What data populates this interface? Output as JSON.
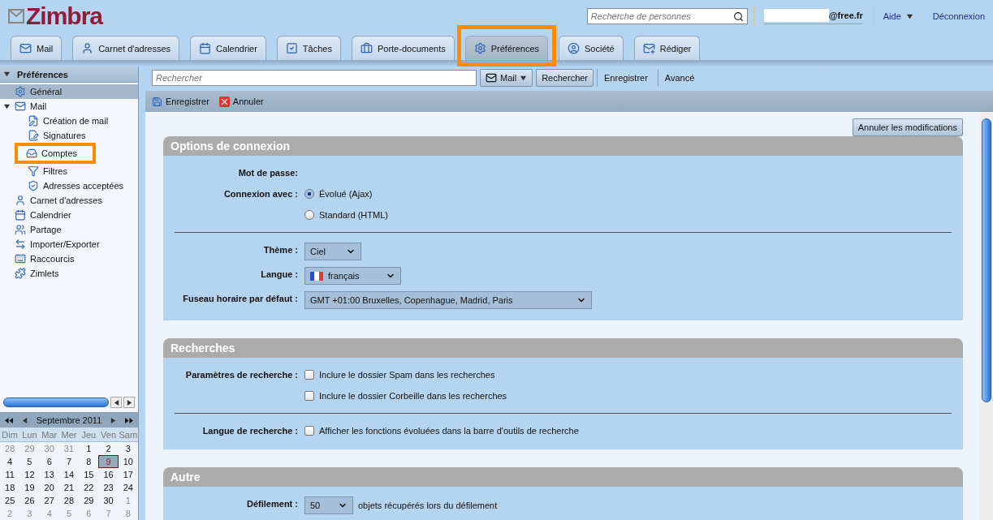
{
  "header": {
    "logo": "Zimbra",
    "people_search": {
      "placeholder": "Recherche de personnes"
    },
    "account": "@free.fr",
    "help": "Aide",
    "logout": "Déconnexion"
  },
  "tabs": [
    {
      "label": "Mail",
      "selected": false,
      "highlighted": false
    },
    {
      "label": "Carnet d'adresses",
      "selected": false,
      "highlighted": false
    },
    {
      "label": "Calendrier",
      "selected": false,
      "highlighted": false
    },
    {
      "label": "Tâches",
      "selected": false,
      "highlighted": false
    },
    {
      "label": "Porte-documents",
      "selected": false,
      "highlighted": false
    },
    {
      "label": "Préférences",
      "selected": true,
      "highlighted": true
    },
    {
      "label": "Société",
      "selected": false,
      "highlighted": false
    },
    {
      "label": "Rédiger",
      "selected": false,
      "highlighted": false
    }
  ],
  "sidebar": {
    "title": "Préférences",
    "items": [
      {
        "label": "Général",
        "selected": true,
        "highlighted": false
      },
      {
        "label": "Mail",
        "selected": false,
        "highlighted": false,
        "expanded": true,
        "children": [
          {
            "label": "Création de mail",
            "selected": false,
            "highlighted": false
          },
          {
            "label": "Signatures",
            "selected": false,
            "highlighted": false
          },
          {
            "label": "Comptes",
            "selected": false,
            "highlighted": true
          },
          {
            "label": "Filtres",
            "selected": false,
            "highlighted": false
          },
          {
            "label": "Adresses acceptées",
            "selected": false,
            "highlighted": false
          }
        ]
      },
      {
        "label": "Carnet d'adresses",
        "selected": false,
        "highlighted": false
      },
      {
        "label": "Calendrier",
        "selected": false,
        "highlighted": false
      },
      {
        "label": "Partage",
        "selected": false,
        "highlighted": false
      },
      {
        "label": "Importer/Exporter",
        "selected": false,
        "highlighted": false
      },
      {
        "label": "Raccourcis",
        "selected": false,
        "highlighted": false
      },
      {
        "label": "Zimlets",
        "selected": false,
        "highlighted": false
      }
    ]
  },
  "calendar": {
    "month": "Septembre 2011",
    "weekdays": [
      "Dim",
      "Lun",
      "Mar",
      "Mer",
      "Jeu",
      "Ven",
      "Sam"
    ],
    "weeks": [
      [
        {
          "day": "28",
          "muted": true,
          "selected": false
        },
        {
          "day": "29",
          "muted": true,
          "selected": false
        },
        {
          "day": "30",
          "muted": true,
          "selected": false
        },
        {
          "day": "31",
          "muted": true,
          "selected": false
        },
        {
          "day": "1",
          "muted": false,
          "selected": false
        },
        {
          "day": "2",
          "muted": false,
          "selected": false
        },
        {
          "day": "3",
          "muted": false,
          "selected": false
        }
      ],
      [
        {
          "day": "4",
          "muted": false,
          "selected": false
        },
        {
          "day": "5",
          "muted": false,
          "selected": false
        },
        {
          "day": "6",
          "muted": false,
          "selected": false
        },
        {
          "day": "7",
          "muted": false,
          "selected": false
        },
        {
          "day": "8",
          "muted": false,
          "selected": false
        },
        {
          "day": "9",
          "muted": false,
          "selected": true
        },
        {
          "day": "10",
          "muted": false,
          "selected": false
        }
      ],
      [
        {
          "day": "11",
          "muted": false,
          "selected": false
        },
        {
          "day": "12",
          "muted": false,
          "selected": false
        },
        {
          "day": "13",
          "muted": false,
          "selected": false
        },
        {
          "day": "14",
          "muted": false,
          "selected": false
        },
        {
          "day": "15",
          "muted": false,
          "selected": false
        },
        {
          "day": "16",
          "muted": false,
          "selected": false
        },
        {
          "day": "17",
          "muted": false,
          "selected": false
        }
      ],
      [
        {
          "day": "18",
          "muted": false,
          "selected": false
        },
        {
          "day": "19",
          "muted": false,
          "selected": false
        },
        {
          "day": "20",
          "muted": false,
          "selected": false
        },
        {
          "day": "21",
          "muted": false,
          "selected": false
        },
        {
          "day": "22",
          "muted": false,
          "selected": false
        },
        {
          "day": "23",
          "muted": false,
          "selected": false
        },
        {
          "day": "24",
          "muted": false,
          "selected": false
        }
      ],
      [
        {
          "day": "25",
          "muted": false,
          "selected": false
        },
        {
          "day": "26",
          "muted": false,
          "selected": false
        },
        {
          "day": "27",
          "muted": false,
          "selected": false
        },
        {
          "day": "28",
          "muted": false,
          "selected": false
        },
        {
          "day": "29",
          "muted": false,
          "selected": false
        },
        {
          "day": "30",
          "muted": false,
          "selected": false
        },
        {
          "day": "1",
          "muted": true,
          "selected": false
        }
      ],
      [
        {
          "day": "2",
          "muted": true,
          "selected": false
        },
        {
          "day": "3",
          "muted": true,
          "selected": false
        },
        {
          "day": "4",
          "muted": true,
          "selected": false
        },
        {
          "day": "5",
          "muted": true,
          "selected": false
        },
        {
          "day": "6",
          "muted": true,
          "selected": false
        },
        {
          "day": "7",
          "muted": true,
          "selected": false
        },
        {
          "day": "8",
          "muted": true,
          "selected": false
        }
      ]
    ]
  },
  "search_bar": {
    "placeholder": "Rechercher",
    "scope": "Mail",
    "search": "Rechercher",
    "save": "Enregistrer",
    "advanced": "Avancé"
  },
  "actions": [
    {
      "label": "Enregistrer",
      "kind": "save"
    },
    {
      "label": "Annuler",
      "kind": "cancel"
    }
  ],
  "revert_button": "Annuler les modifications",
  "sections": [
    {
      "title": "Options de connexion",
      "rows": [
        {
          "kind": "text",
          "label": "Mot de passe:"
        },
        {
          "kind": "radio",
          "label": "Connexion avec :",
          "options": [
            {
              "label": "Évolué (Ajax)",
              "selected": true
            },
            {
              "label": "Standard (HTML)",
              "selected": false
            }
          ]
        },
        {
          "kind": "divider"
        },
        {
          "kind": "select",
          "label": "Thème :",
          "value": "Ciel"
        },
        {
          "kind": "flag-select",
          "label": "Langue :",
          "value": "français"
        },
        {
          "kind": "select",
          "label": "Fuseau horaire par défaut :",
          "value": "GMT +01:00 Bruxelles, Copenhague, Madrid, Paris"
        }
      ]
    },
    {
      "title": "Recherches",
      "rows": [
        {
          "kind": "checkbox",
          "label": "Paramètres de recherche :",
          "options": [
            {
              "label": "Inclure le dossier Spam dans les recherches",
              "checked": false
            },
            {
              "label": "Inclure le dossier Corbeille dans les recherches",
              "checked": false
            }
          ]
        },
        {
          "kind": "divider"
        },
        {
          "kind": "checkbox",
          "label": "Langue de recherche :",
          "options": [
            {
              "label": "Afficher les fonctions évoluées dans la barre d'outils de recherche",
              "checked": false
            }
          ]
        }
      ]
    },
    {
      "title": "Autre",
      "rows": [
        {
          "kind": "select",
          "label": "Défilement :",
          "value": "50",
          "suffix": "objets récupérés lors du défilement"
        }
      ]
    }
  ]
}
